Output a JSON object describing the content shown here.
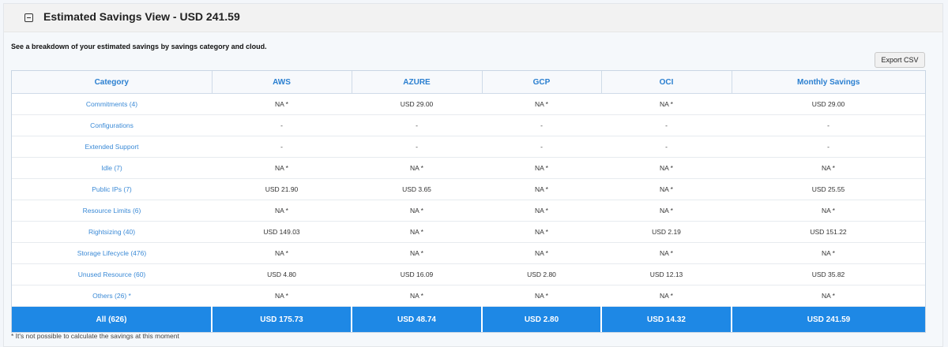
{
  "panel": {
    "title": "Estimated Savings View - USD 241.59",
    "description": "See a breakdown of your estimated savings by savings category and cloud.",
    "export_label": "Export CSV"
  },
  "table": {
    "headers": [
      "Category",
      "AWS",
      "AZURE",
      "GCP",
      "OCI",
      "Monthly Savings"
    ],
    "rows": [
      [
        "Commitments (4)",
        "NA *",
        "USD 29.00",
        "NA *",
        "NA *",
        "USD 29.00"
      ],
      [
        "Configurations",
        "-",
        "-",
        "-",
        "-",
        "-"
      ],
      [
        "Extended Support",
        "-",
        "-",
        "-",
        "-",
        "-"
      ],
      [
        "Idle (7)",
        "NA *",
        "NA *",
        "NA *",
        "NA *",
        "NA *"
      ],
      [
        "Public IPs (7)",
        "USD 21.90",
        "USD 3.65",
        "NA *",
        "NA *",
        "USD 25.55"
      ],
      [
        "Resource Limits (6)",
        "NA *",
        "NA *",
        "NA *",
        "NA *",
        "NA *"
      ],
      [
        "Rightsizing (40)",
        "USD 149.03",
        "NA *",
        "NA *",
        "USD 2.19",
        "USD 151.22"
      ],
      [
        "Storage Lifecycle (476)",
        "NA *",
        "NA *",
        "NA *",
        "NA *",
        "NA *"
      ],
      [
        "Unused Resource (60)",
        "USD 4.80",
        "USD 16.09",
        "USD 2.80",
        "USD 12.13",
        "USD 35.82"
      ],
      [
        "Others (26) *",
        "NA *",
        "NA *",
        "NA *",
        "NA *",
        "NA *"
      ]
    ],
    "total": [
      "All (626)",
      "USD 175.73",
      "USD 48.74",
      "USD 2.80",
      "USD 14.32",
      "USD 241.59"
    ]
  },
  "footnote": "* It's not possible to calculate the savings at this moment",
  "colors": {
    "accent": "#1e88e5",
    "link": "#3b8ad6"
  }
}
